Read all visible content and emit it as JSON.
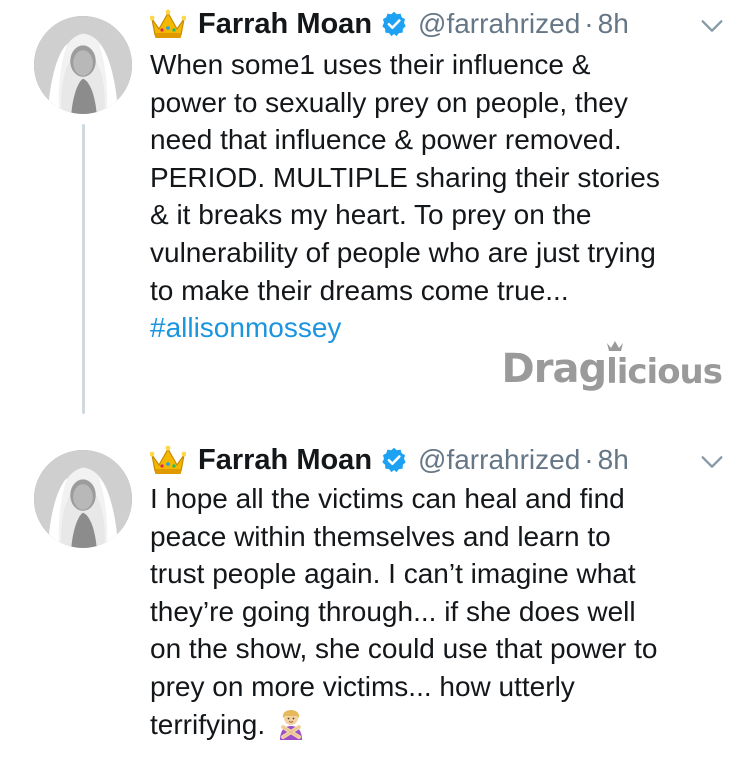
{
  "tweets": [
    {
      "display_name": "Farrah Moan",
      "handle": "@farrahrized",
      "separator": "·",
      "time": "8h",
      "lines": [
        "When some1 uses their influence &",
        "power to sexually prey on people, they",
        "need that influence & power removed.",
        "PERIOD. MULTIPLE sharing their stories",
        "& it breaks my heart. To prey on the",
        "vulnerability of people who are just trying",
        "to make their dreams come true..."
      ],
      "hashtag": "#allisonmossey"
    },
    {
      "display_name": "Farrah Moan",
      "handle": "@farrahrized",
      "separator": "·",
      "time": "8h",
      "lines": [
        "I hope all the victims can heal and find",
        "peace within themselves and learn to",
        "trust people again. I can’t imagine what",
        "they’re going through... if she does well",
        "on the show, she could use that power to",
        "prey on more victims... how utterly",
        "terrifying."
      ],
      "trailing_emoji": "person-gesturing-no-icon"
    }
  ],
  "watermark": {
    "part_a": "Drag",
    "part_b": "licious"
  },
  "icons": {
    "crown": "crown-icon",
    "verified": "verified-badge-icon",
    "caret": "chevron-down-icon"
  },
  "colors": {
    "text": "#14171a",
    "secondary": "#657786",
    "link": "#1b95e0",
    "verified": "#1da1f2",
    "thread_line": "#cfd9de",
    "watermark": "#9a9a9a"
  }
}
